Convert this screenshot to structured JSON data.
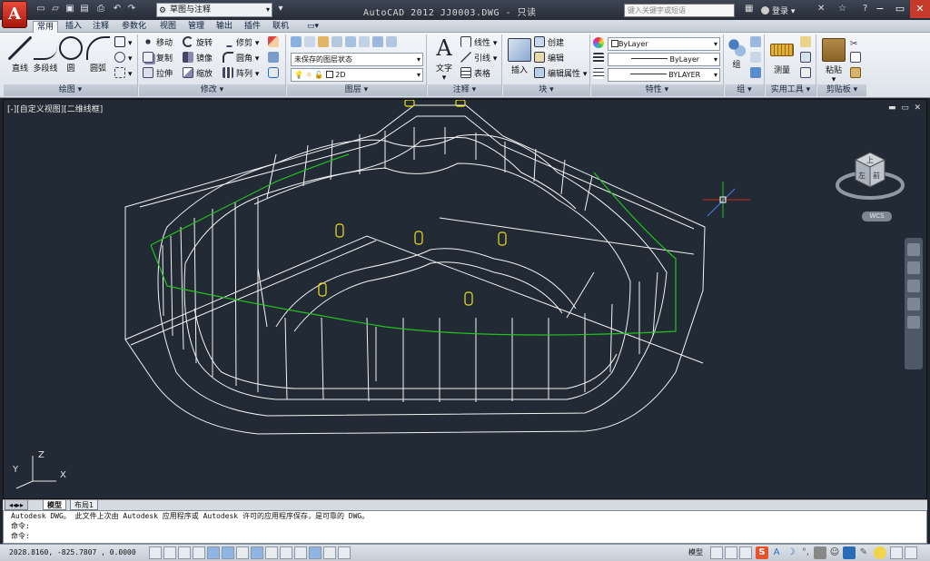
{
  "title": {
    "app": "AutoCAD 2012",
    "file": "JJ0003.DWG - 只读",
    "window_title": "AutoCAD 2012    JJ0003.DWG - 只读"
  },
  "workspace": {
    "value": "草图与注释"
  },
  "search": {
    "placeholder": "键入关键字或短语"
  },
  "user": {
    "login": "登录"
  },
  "tabs": [
    "常用",
    "插入",
    "注释",
    "参数化",
    "视图",
    "管理",
    "输出",
    "插件",
    "联机"
  ],
  "ribbon": {
    "draw": {
      "title": "绘图",
      "line": "直线",
      "polyline": "多段线",
      "circle": "圆",
      "arc": "圆弧"
    },
    "modify": {
      "title": "修改",
      "move": "移动",
      "rotate": "旋转",
      "trim": "修剪",
      "copy": "复制",
      "mirror": "镜像",
      "fillet": "圆角",
      "stretch": "拉伸",
      "scale": "缩放",
      "array": "阵列"
    },
    "layers": {
      "title": "图层",
      "layer_state": "未保存的图层状态",
      "current_layer": "2D"
    },
    "annotation": {
      "title": "注释",
      "text": "文字",
      "linear": "线性",
      "leader": "引线",
      "table": "表格"
    },
    "block": {
      "title": "块",
      "insert": "插入",
      "create": "创建",
      "edit": "编辑",
      "edit_attr": "编辑属性"
    },
    "properties": {
      "title": "特性",
      "color": "ByLayer",
      "linetype": "ByLayer",
      "lineweight": "BYLAYER"
    },
    "groups": {
      "title": "组",
      "group": "组"
    },
    "utilities": {
      "title": "实用工具",
      "measure": "测量"
    },
    "clipboard": {
      "title": "剪贴板",
      "paste": "粘贴"
    }
  },
  "viewport": {
    "label": "[-][自定义视图][二维线框]",
    "cube_top": "上",
    "cube_left": "左",
    "cube_front": "前",
    "wcs": "WCS",
    "ucs_x": "X",
    "ucs_y": "Y",
    "ucs_z": "Z"
  },
  "layout_tabs": [
    "模型",
    "布局1"
  ],
  "command": {
    "lines": [
      "Autodesk DWG。  此文件上次由 Autodesk 应用程序或 Autodesk 许可的应用程序保存，是可靠的 DWG。",
      "命令:",
      "命令:"
    ]
  },
  "status": {
    "coords": "2028.8160,  -825.7807 , 0.0000",
    "model": "模型"
  },
  "colors": {
    "viewport_bg": "#222a35",
    "wire": "#ffffff",
    "green_line": "#22c21e",
    "yellow": "#f0e01a",
    "accent_red": "#d42a1a"
  }
}
